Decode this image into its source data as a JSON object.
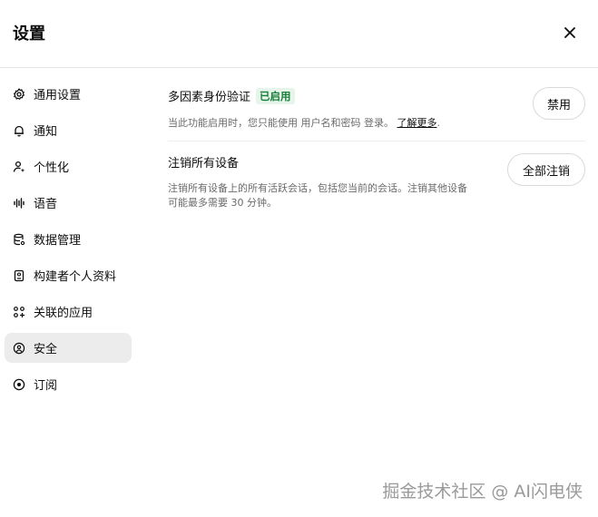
{
  "header": {
    "title": "设置",
    "close_icon": "close-icon"
  },
  "sidebar": {
    "items": [
      {
        "label": "通用设置",
        "icon": "gear-icon",
        "active": false
      },
      {
        "label": "通知",
        "icon": "bell-icon",
        "active": false
      },
      {
        "label": "个性化",
        "icon": "person-sparkle-icon",
        "active": false
      },
      {
        "label": "语音",
        "icon": "waveform-icon",
        "active": false
      },
      {
        "label": "数据管理",
        "icon": "database-icon",
        "active": false
      },
      {
        "label": "构建者个人资料",
        "icon": "id-card-icon",
        "active": false
      },
      {
        "label": "关联的应用",
        "icon": "apps-grid-icon",
        "active": false
      },
      {
        "label": "安全",
        "icon": "shield-lock-icon",
        "active": true
      },
      {
        "label": "订阅",
        "icon": "target-icon",
        "active": false
      }
    ]
  },
  "security": {
    "mfa": {
      "title": "多因素身份验证",
      "badge": "已启用",
      "description_prefix": "当此功能启用时，您只能使用 用户名和密码 登录。",
      "learn_more": "了解更多",
      "description_suffix": ".",
      "button": "禁用"
    },
    "logout": {
      "title": "注销所有设备",
      "description": "注销所有设备上的所有活跃会话，包括您当前的会话。注销其他设备可能最多需要 30 分钟。",
      "button": "全部注销"
    }
  },
  "watermark": "掘金技术社区 @ AI闪电侠",
  "colors": {
    "active_nav_bg": "#ececec",
    "badge_bg": "#e6f4ea",
    "badge_text": "#188038",
    "muted_text": "#6b6b6b",
    "border": "#e5e5e5"
  }
}
